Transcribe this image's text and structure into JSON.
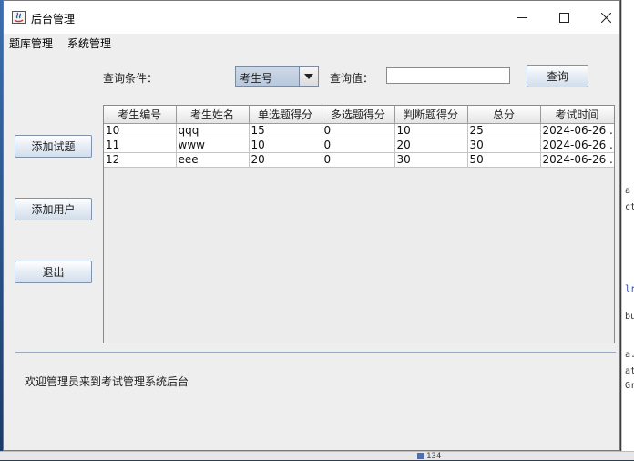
{
  "window": {
    "title": "后台管理"
  },
  "menubar": {
    "items": [
      "题库管理",
      "系统管理"
    ]
  },
  "query": {
    "condition_label": "查询条件：",
    "condition_selected": "考生号",
    "value_label": "查询值：",
    "value_input": "",
    "search_button": "查询"
  },
  "sidebar": {
    "add_question": "添加试题",
    "add_user": "添加用户",
    "exit": "退出"
  },
  "table": {
    "columns": [
      "考生编号",
      "考生姓名",
      "单选题得分",
      "多选题得分",
      "判断题得分",
      "总分",
      "考试时间"
    ],
    "rows": [
      [
        "10",
        "qqq",
        "15",
        "0",
        "10",
        "25",
        "2024-06-26 ..."
      ],
      [
        "11",
        "www",
        "10",
        "0",
        "20",
        "30",
        "2024-06-26 ..."
      ],
      [
        "12",
        "eee",
        "20",
        "0",
        "30",
        "50",
        "2024-06-26 ..."
      ]
    ]
  },
  "status": {
    "message": "欢迎管理员来到考试管理系统后台"
  },
  "background": {
    "right_fragments": [
      "a",
      "ct",
      "lr",
      "bu",
      "a.",
      "at",
      "Gr"
    ],
    "bottom_fragment": "134"
  },
  "colors": {
    "window_bg": "#eeeeee",
    "button_border": "#7f93ad",
    "combo_bg": "#b8c8dd",
    "separator": "#9aa8c0"
  }
}
